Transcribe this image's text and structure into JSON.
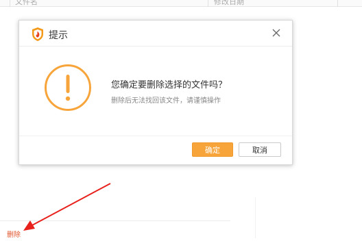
{
  "background": {
    "header_col1": "文件名",
    "header_col2": "修改日期",
    "delete_link": "删除"
  },
  "dialog": {
    "title": "提示",
    "icon": "shield-logo-icon",
    "close_icon": "close-icon",
    "warning_icon": "warning-circle-icon",
    "message": "您确定要删除选择的文件吗？",
    "sub_message": "删除后无法找回该文件，请谨慎操作",
    "ok_label": "确定",
    "cancel_label": "取消"
  },
  "colors": {
    "accent": "#f7a53b",
    "link": "#e0562d",
    "arrow": "#e8211c"
  }
}
